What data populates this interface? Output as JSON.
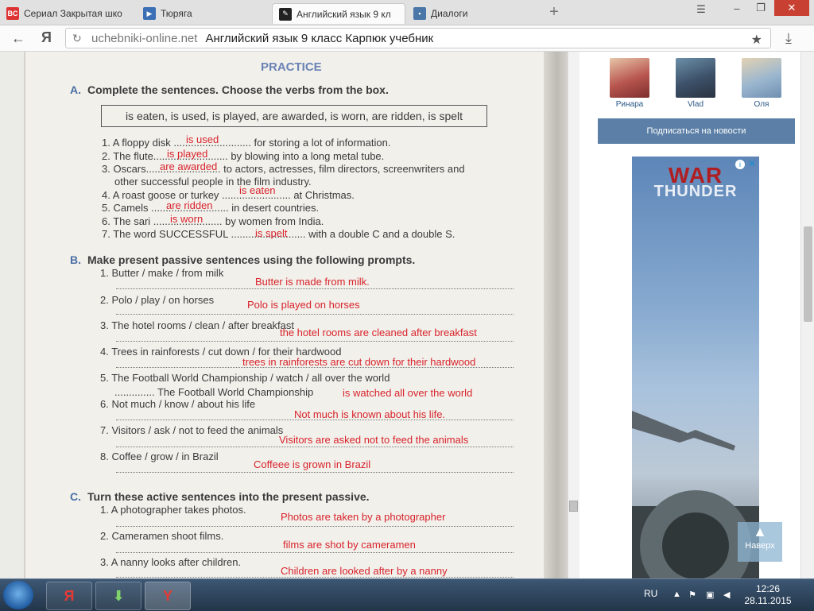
{
  "browser": {
    "tabs": [
      {
        "label": "Сериал Закрытая шко",
        "favicon": "bc-icon",
        "active": false
      },
      {
        "label": "Тюряга",
        "favicon": "video-icon",
        "active": false
      },
      {
        "label": "Английский язык 9 кл",
        "favicon": "book-icon",
        "active": true
      },
      {
        "label": "Диалоги",
        "favicon": "chat-icon",
        "active": false
      }
    ],
    "address": {
      "domain": "uchebniki-online.net",
      "title": "Английский язык 9 класс Карпюк учебник"
    },
    "yandex_mark": "Я"
  },
  "book": {
    "heading": "PRACTICE",
    "section_a": {
      "letter": "A.",
      "title": "Complete the sentences. Choose the verbs from the box.",
      "box": "is eaten, is used, is played, are awarded, is worn, are ridden, is spelt",
      "lines": [
        "1. A floppy disk ........................... for storing a lot of information.",
        "2. The flute.......................... by blowing into a long metal tube.",
        "3. Oscars.......................... to actors, actresses, film directors, screenwriters and",
        "other successful people in the film industry.",
        "4. A roast goose or turkey ........................ at Christmas.",
        "5. Camels ........................... in desert countries.",
        "6. The sari ........................ by women from India.",
        "7. The word SUCCESSFUL .......................... with a double C and a double S."
      ],
      "answers": [
        "is used",
        "is played",
        "are awarded",
        "is eaten",
        "are ridden",
        "is worn",
        "is spelt"
      ]
    },
    "section_b": {
      "letter": "B.",
      "title": "Make present passive sentences using the following prompts.",
      "prompts": [
        "1. Butter / make / from milk",
        "2. Polo / play / on horses",
        "3. The hotel rooms / clean / after breakfast",
        "4. Trees in rainforests / cut down / for their hardwood",
        "5. The Football World Championship / watch / all over the world",
        "6. Not much / know / about his life",
        "7. Visitors / ask / not to feed the animals",
        "8. Coffee / grow / in Brazil"
      ],
      "extra_print": ".............. The Football World Championship",
      "answers": [
        "Butter is made from milk.",
        "Polo is played on horses",
        "the hotel rooms are cleaned after breakfast",
        "trees in rainforests are cut down for their hardwood",
        "is watched all over the world",
        "Not much is known about his life.",
        "Visitors are asked not to feed the animals",
        "Coffeee is grown in Brazil"
      ]
    },
    "section_c": {
      "letter": "C.",
      "title": "Turn these active sentences into the present passive.",
      "prompts": [
        "1. A photographer takes photos.",
        "2. Cameramen shoot films.",
        "3. A nanny looks after children."
      ],
      "answers": [
        "Photos are taken by a photographer",
        "films are shot by cameramen",
        "Children are looked after by a nanny"
      ]
    }
  },
  "sidebar": {
    "friends": [
      {
        "name": "Ринара",
        "color": "#b8554f"
      },
      {
        "name": "Vlad",
        "color": "#3c5068"
      },
      {
        "name": "Оля",
        "color": "#9ab6cf"
      }
    ],
    "subscribe_label": "Подписаться на новости",
    "ad": {
      "logo_line1": "WAR",
      "logo_line2": "THUNDER"
    },
    "to_top_label": "Наверх"
  },
  "taskbar": {
    "apps": [
      "yandex-icon",
      "download-manager-icon",
      "yandex-browser-icon"
    ],
    "language": "RU",
    "time": "12:26",
    "date": "28.11.2015"
  },
  "colors": {
    "answer_red": "#d9232b",
    "section_blue": "#4a6fa5",
    "subscribe_bg": "#5b7fa6"
  }
}
